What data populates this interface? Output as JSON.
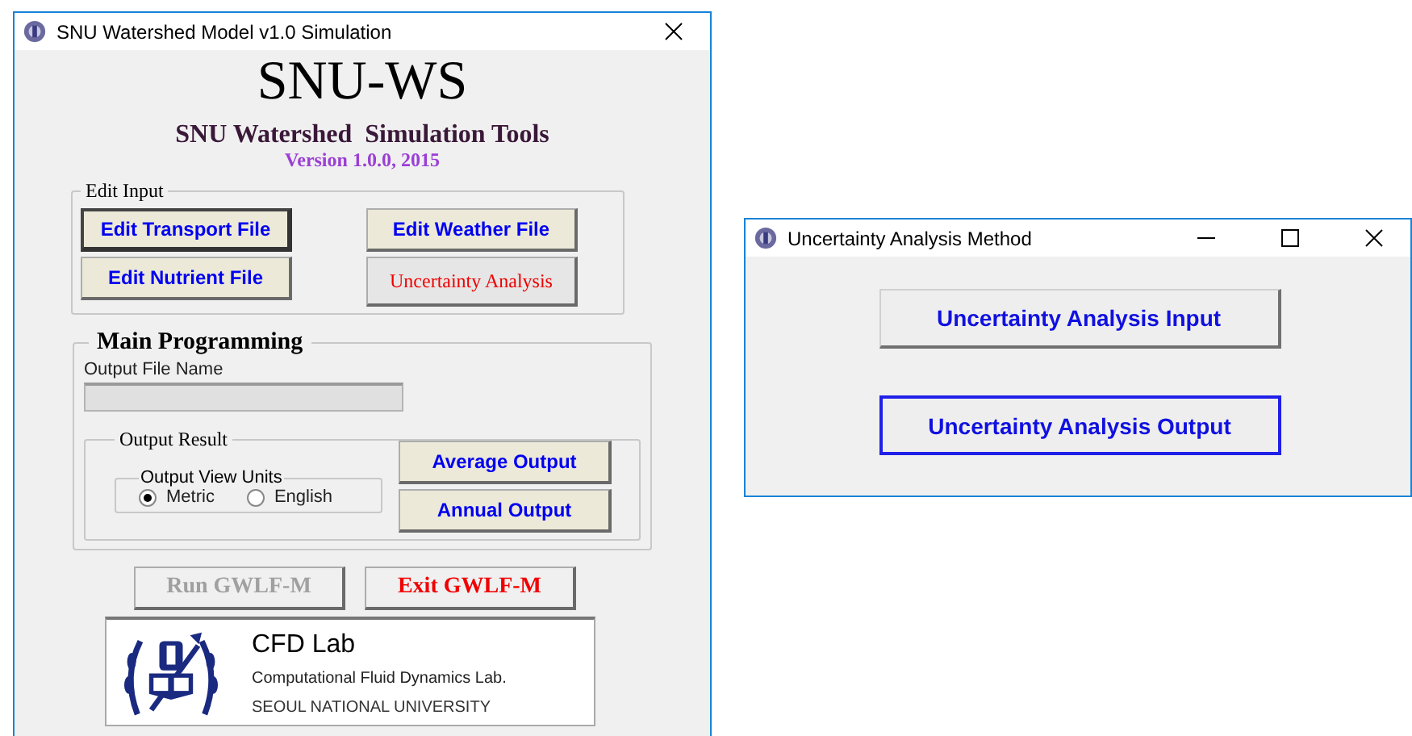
{
  "main_window": {
    "title": "SNU Watershed Model v1.0 Simulation",
    "heading": "SNU-WS",
    "subtitle": "SNU Watershed  Simulation Tools",
    "version": "Version 1.0.0, 2015",
    "edit_input": {
      "legend": "Edit Input",
      "buttons": [
        {
          "label": "Edit Transport File",
          "kind": "file",
          "focused": true
        },
        {
          "label": "Edit Weather File",
          "kind": "file",
          "focused": false
        },
        {
          "label": "Edit Nutrient File",
          "kind": "file",
          "focused": false
        },
        {
          "label": "Uncertainty Analysis",
          "kind": "tool",
          "focused": false
        }
      ]
    },
    "main_programming": {
      "legend": "Main Programming",
      "output_file_label": "Output File Name",
      "output_file_field": {
        "disabled": true
      },
      "output_result": {
        "legend": "Output Result",
        "units": {
          "legend": "Output View Units",
          "options": [
            {
              "label": "Metric",
              "selected": true
            },
            {
              "label": "English",
              "selected": false
            }
          ]
        },
        "buttons": [
          {
            "label": "Average Output"
          },
          {
            "label": "Annual Output"
          }
        ]
      }
    },
    "actions": [
      {
        "label": "Run GWLF-M",
        "disabled": true
      },
      {
        "label": "Exit GWLF-M",
        "disabled": false
      }
    ],
    "lab": {
      "name": "CFD Lab",
      "full_name": "Computational Fluid Dynamics Lab.",
      "university": "SEOUL NATIONAL UNIVERSITY"
    }
  },
  "dialog": {
    "title": "Uncertainty Analysis Method",
    "buttons": [
      {
        "label": "Uncertainty Analysis Input",
        "focused": false
      },
      {
        "label": "Uncertainty Analysis Output",
        "focused": true
      }
    ]
  }
}
